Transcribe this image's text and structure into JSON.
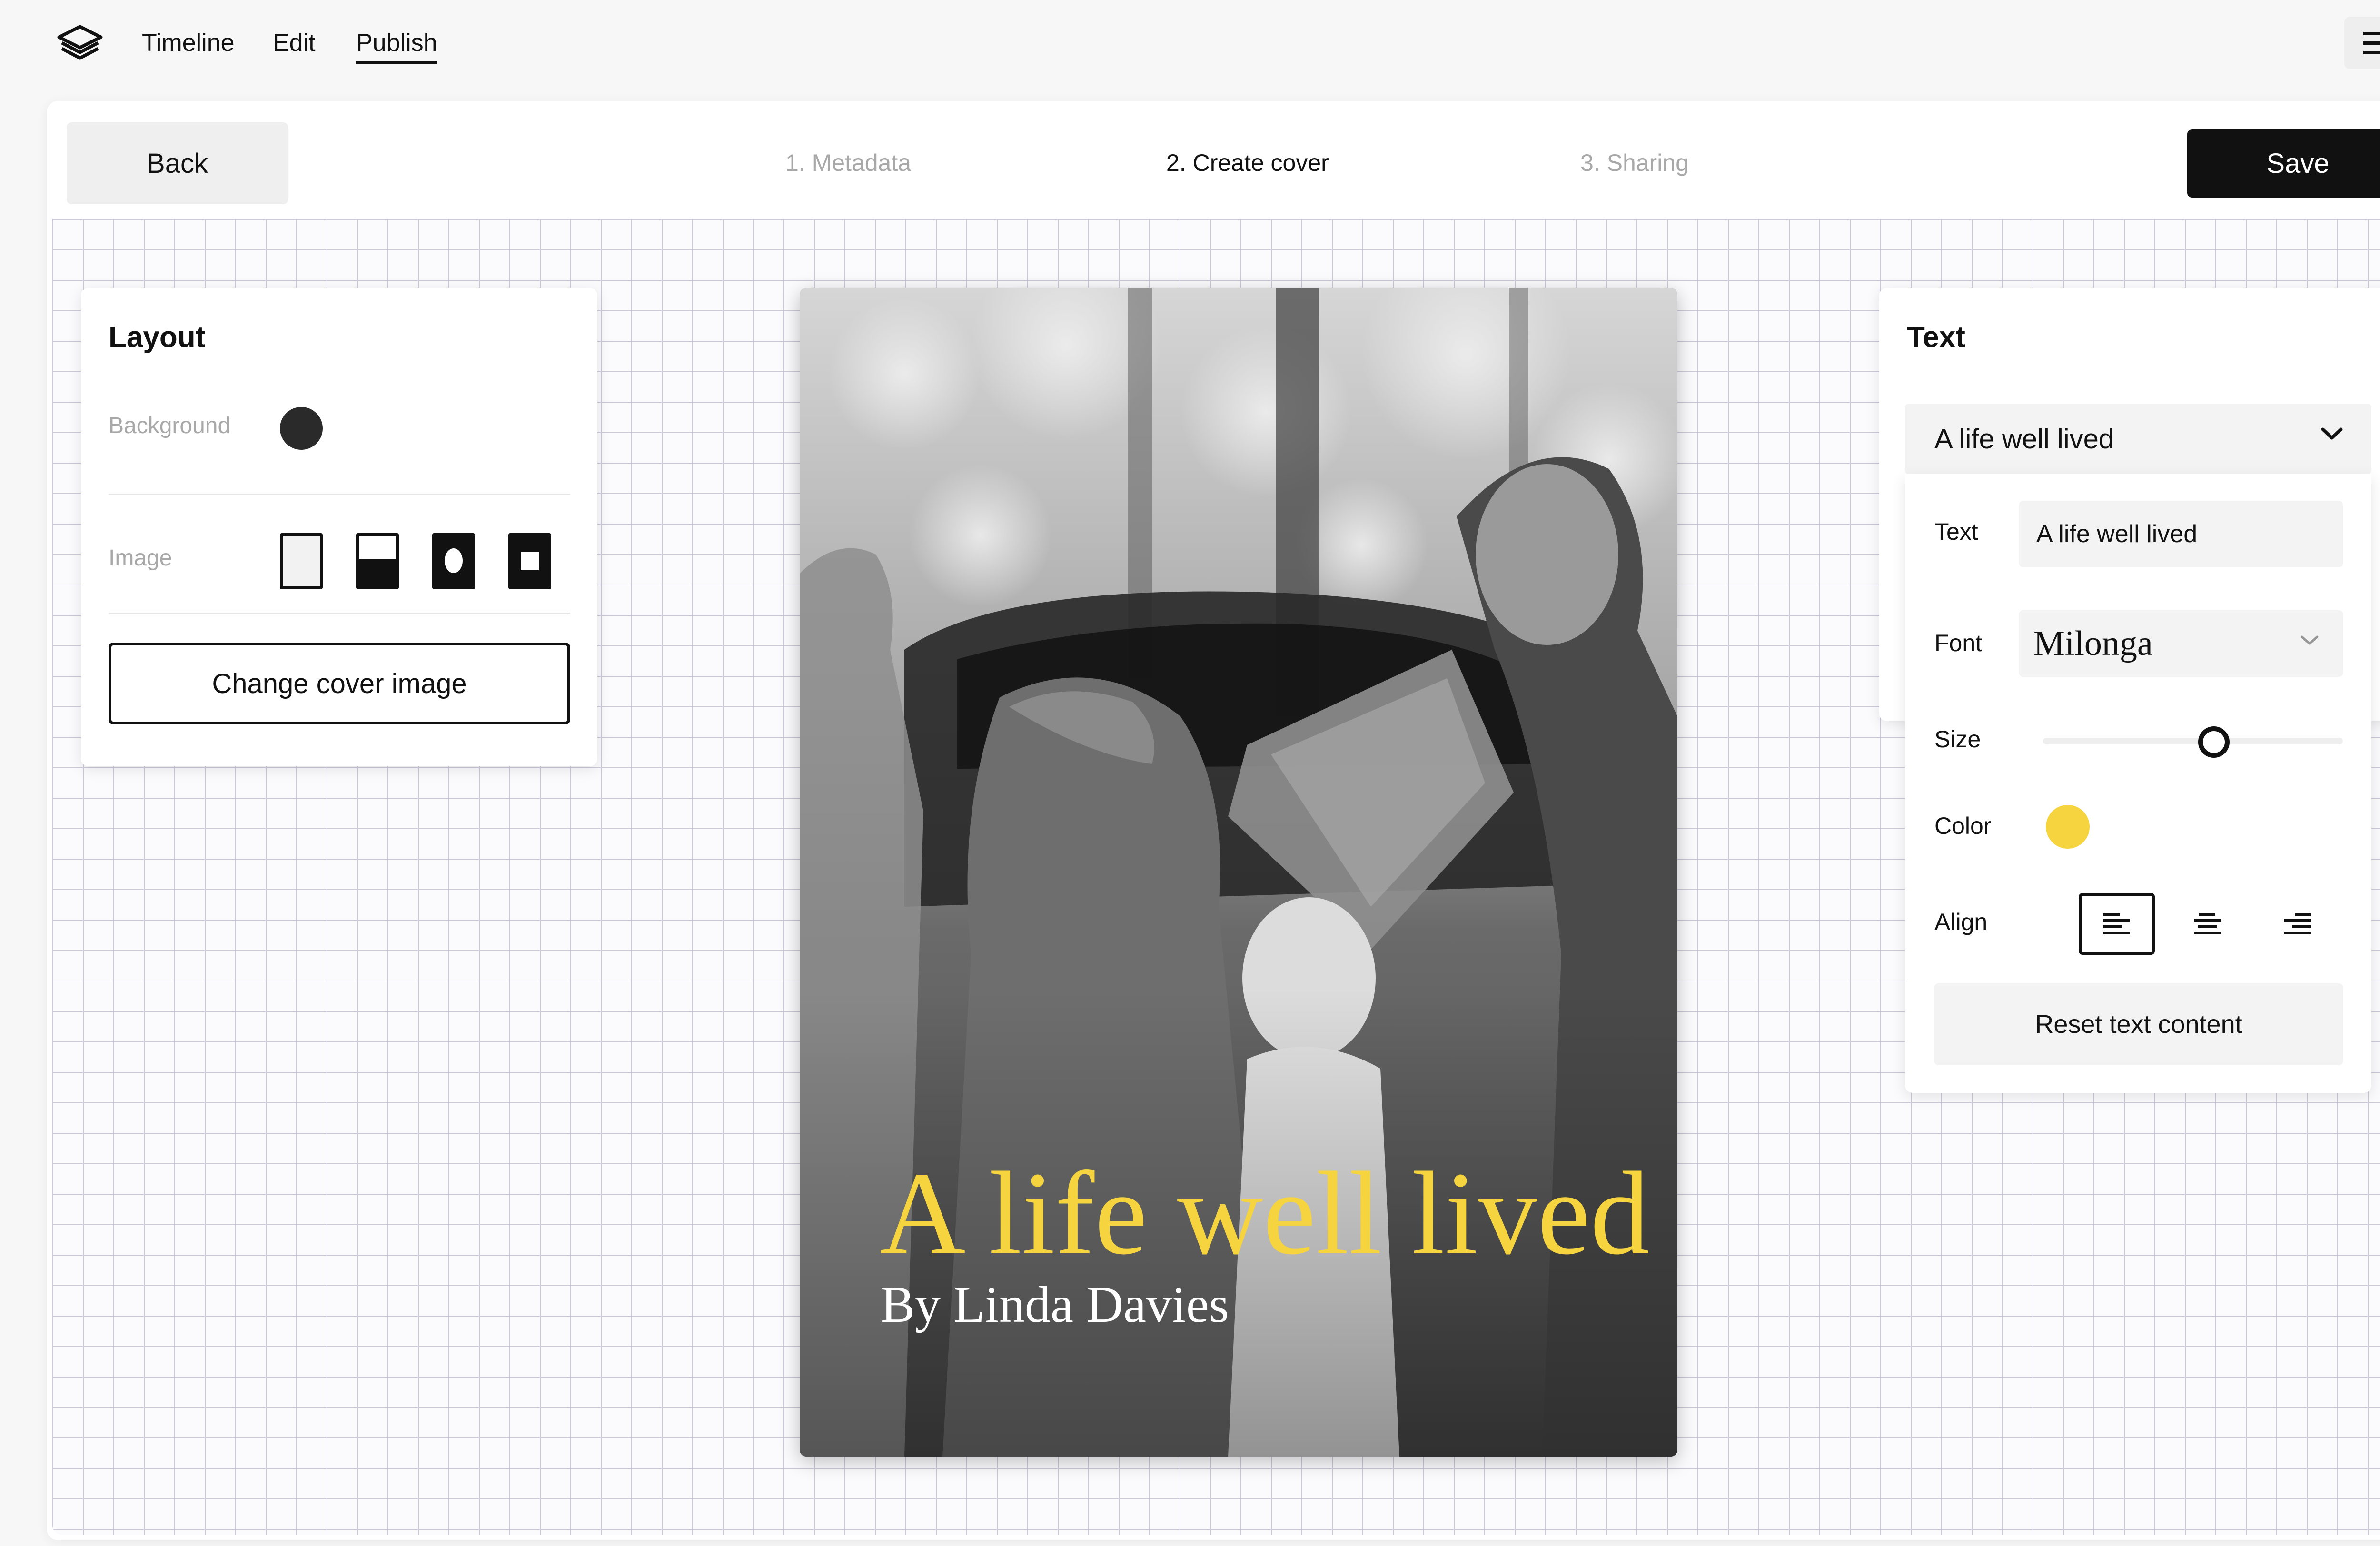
{
  "nav": {
    "links": [
      "Timeline",
      "Edit",
      "Publish"
    ],
    "active": "Publish"
  },
  "toolbar": {
    "back_label": "Back",
    "save_label": "Save",
    "steps": [
      "1. Metadata",
      "2. Create cover",
      "3. Sharing"
    ],
    "current_step": 1
  },
  "layout_panel": {
    "title": "Layout",
    "background_label": "Background",
    "background_color": "#2a2a2a",
    "image_label": "Image",
    "image_options": [
      "blank",
      "half-band",
      "oval",
      "square"
    ],
    "change_image_label": "Change cover image"
  },
  "cover": {
    "title": "A life well lived",
    "subtitle": "By Linda Davies"
  },
  "text_panel": {
    "title": "Text",
    "selected_item": "A life well lived",
    "text_label": "Text",
    "text_value": "A life well lived",
    "font_label": "Font",
    "font_value": "Milonga",
    "size_label": "Size",
    "size_level": 0.57,
    "color_label": "Color",
    "color_value": "#f5d43f",
    "align_label": "Align",
    "align_options": [
      "left",
      "center",
      "right"
    ],
    "align_active": "left",
    "reset_label": "Reset text content"
  }
}
